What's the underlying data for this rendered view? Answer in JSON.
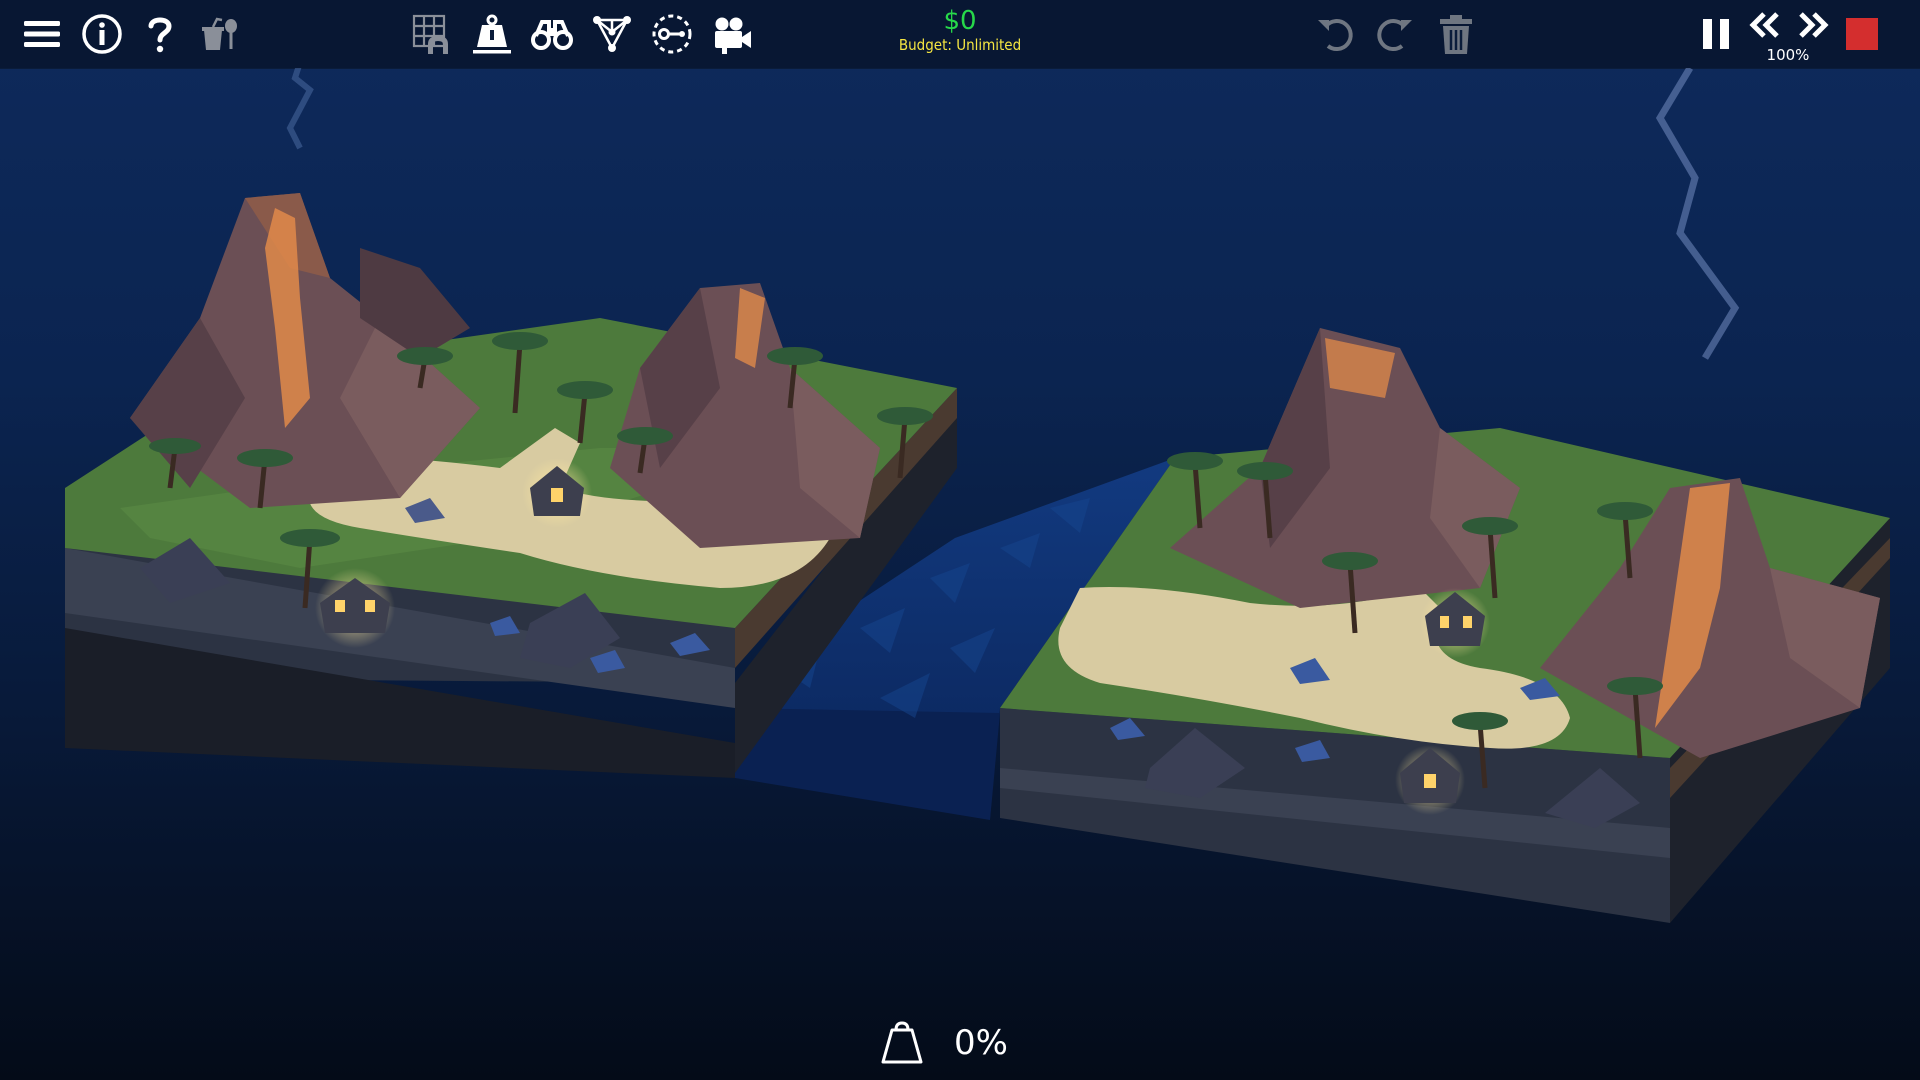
{
  "toolbar": {
    "left_buttons": [
      "menu-icon",
      "info-icon",
      "help-icon",
      "theme-tools-icon"
    ],
    "center_buttons": [
      "grid-anchor-icon",
      "weight-icon",
      "binoculars-icon",
      "stress-nodes-icon",
      "joint-icon",
      "camera-icon"
    ],
    "budget_amount": "$0",
    "budget_label": "Budget: Unlimited",
    "history_buttons": [
      "undo-icon",
      "redo-icon",
      "trash-icon"
    ],
    "playback_buttons": [
      "pause-icon",
      "slow-down-icon",
      "speed-up-icon",
      "stop-icon"
    ],
    "speed_label": "100%"
  },
  "status": {
    "load_icon": "weight-bag-icon",
    "stress_value": "0%"
  },
  "colors": {
    "budget_amount": "#27d84a",
    "budget_label": "#f5e642",
    "stop": "#d42e2e",
    "water": "#0d2f6e",
    "grass": "#4d7a3c",
    "rock": "#6b4f55",
    "lava": "#e08a4a",
    "sand": "#d8cba1"
  }
}
